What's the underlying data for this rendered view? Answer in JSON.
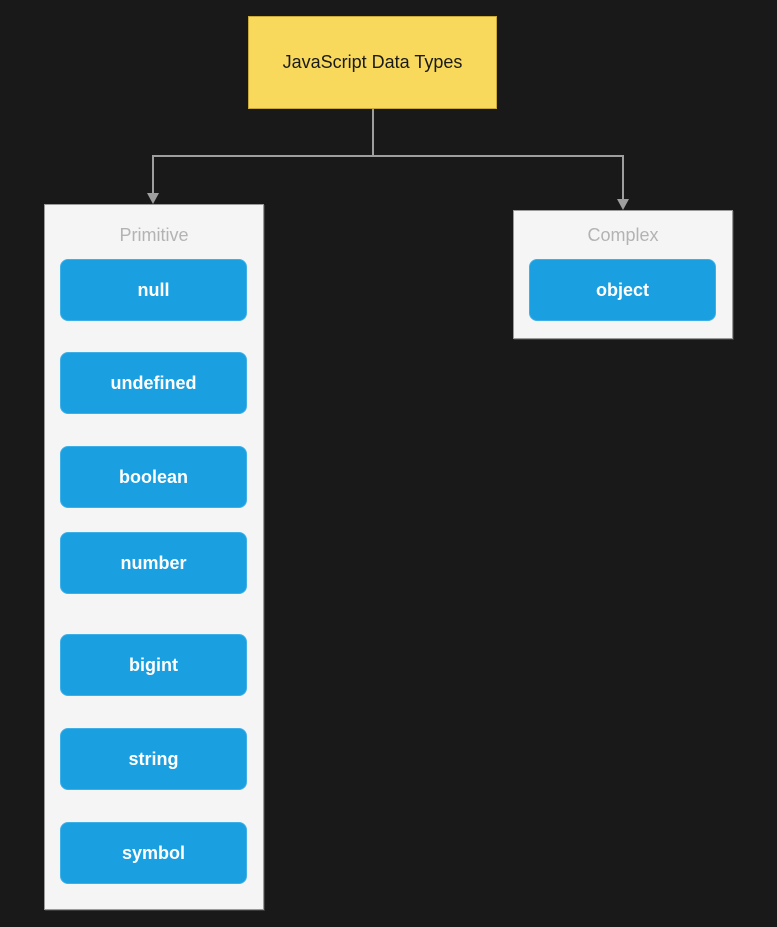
{
  "diagram": {
    "root": {
      "label": "JavaScript Data Types",
      "color": "#f8d95c"
    },
    "groups": {
      "primitive": {
        "label": "Primitive",
        "items": [
          "null",
          "undefined",
          "boolean",
          "number",
          "bigint",
          "string",
          "symbol"
        ]
      },
      "complex": {
        "label": "Complex",
        "items": [
          "object"
        ]
      }
    },
    "edges": [
      {
        "from": "JavaScript Data Types",
        "to": "Primitive"
      },
      {
        "from": "JavaScript Data Types",
        "to": "Complex"
      }
    ],
    "colors": {
      "background": "#191919",
      "group_fill": "#f5f5f5",
      "group_label": "#b3b3b3",
      "node_fill": "#1a9fe0",
      "node_text": "#ffffff",
      "connector": "#9e9e9e"
    }
  }
}
